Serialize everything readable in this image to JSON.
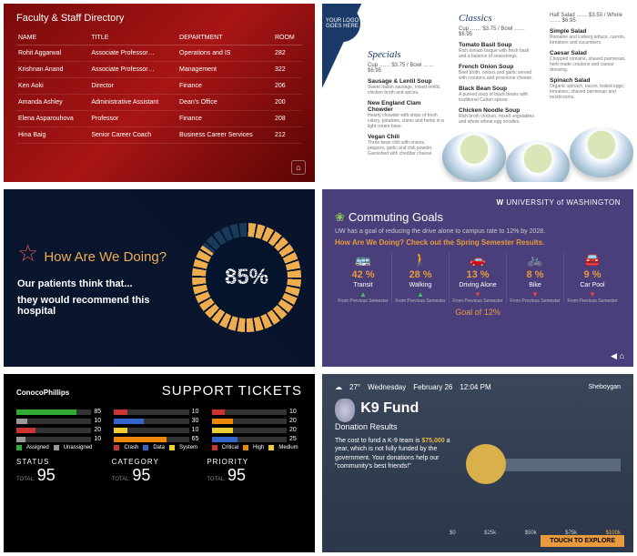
{
  "directory": {
    "title": "Faculty & Staff Directory",
    "headers": [
      "NAME",
      "TITLE",
      "DEPARTMENT",
      "ROOM"
    ],
    "rows": [
      [
        "Rohit Aggarwal",
        "Associate Professor…",
        "Operations and IS",
        "282"
      ],
      [
        "Krishnan Anand",
        "Associate Professor…",
        "Management",
        "322"
      ],
      [
        "Ken Aoki",
        "Director",
        "Finance",
        "206"
      ],
      [
        "Amanda Ashley",
        "Administrative Assistant",
        "Dean's Office",
        "200"
      ],
      [
        "Elena Asparouhova",
        "Professor",
        "Finance",
        "208"
      ],
      [
        "Hina Baig",
        "Senior Career Coach",
        "Business Career Services",
        "212"
      ]
    ]
  },
  "menu": {
    "logo": "YOUR LOGO GOES HERE",
    "specials": {
      "title": "Specials",
      "price": "Cup …… $3.75 / Bowl …… $6.95",
      "items": [
        {
          "name": "Sausage & Lentil Soup",
          "desc": "Sweet Italian sausage, mixed lentils, chicken broth and spices."
        },
        {
          "name": "New England Clam Chowder",
          "desc": "Hearty chowder with strips of fresh celery, potatoes, clams and herbs in a light cream base."
        },
        {
          "name": "Vegan Chili",
          "desc": "Three bean chili with onions, peppers, garlic and chili powder. Garnished with cheddar cheese."
        }
      ]
    },
    "classics": {
      "title": "Classics",
      "price": "Cup …… $3.75 / Bowl …… $6.95",
      "items": [
        {
          "name": "Tomato Basil Soup",
          "desc": "Rich tomato bisque with fresh basil and a balance of seasonings."
        },
        {
          "name": "French Onion Soup",
          "desc": "Beef broth, onions and garlic served with croutons and provolone cheese."
        },
        {
          "name": "Black Bean Soup",
          "desc": "A pureed soup of black beans with traditional Cuban spices."
        },
        {
          "name": "Chicken Noodle Soup",
          "desc": "Rich broth chicken, mixed vegetables and whole wheat egg noodles."
        }
      ]
    },
    "salads": {
      "price": "Half Salad …… $3.50 / Whole …… $6.95",
      "items": [
        {
          "name": "Simple Salad",
          "desc": "Romaine and iceberg lettuce, carrots, tomatoes and cucumbers."
        },
        {
          "name": "Caesar Salad",
          "desc": "Chopped romaine, shaved parmesan, herb made croutons and caesar dressing."
        },
        {
          "name": "Spinach Salad",
          "desc": "Organic spinach, bacon, boiled eggs, tomatoes, shaved parmesan and mushrooms."
        }
      ]
    }
  },
  "survey": {
    "heading": "How Are\nWe Doing?",
    "line1": "Our patients think that...",
    "line2": "they would recommend this hospital",
    "percent": "85%"
  },
  "commute": {
    "org": "UNIVERSITY of WASHINGTON",
    "title": "Commuting Goals",
    "desc": "UW has a goal of reducing the drive alone to campus rate to 12% by 2028.",
    "question": "How Are We Doing? Check out the Spring Semester Results.",
    "modes": [
      {
        "icon": "🚌",
        "pct": "42 %",
        "label": "Transit",
        "dir": "up"
      },
      {
        "icon": "🚶",
        "pct": "28 %",
        "label": "Walking",
        "dir": "up"
      },
      {
        "icon": "🚗",
        "pct": "13 %",
        "label": "Driving Alone",
        "dir": "dn"
      },
      {
        "icon": "🚲",
        "pct": "8 %",
        "label": "Bike",
        "dir": "dn"
      },
      {
        "icon": "🚘",
        "pct": "9 %",
        "label": "Car Pool",
        "dir": "dn"
      }
    ],
    "prev": "From Previous Semester",
    "goal": "Goal of 12%"
  },
  "tickets": {
    "brand": "ConocoPhillips",
    "title": "SUPPORT TICKETS",
    "col1": {
      "legend": [
        [
          "#3a3",
          "Assigned"
        ],
        [
          "#999",
          "Unassigned"
        ]
      ],
      "rows": [
        [
          85,
          "#3a3",
          80
        ],
        [
          10,
          "#999",
          15
        ],
        [
          20,
          "#c33",
          25
        ],
        [
          10,
          "#999",
          12
        ]
      ]
    },
    "col2": {
      "legend": [
        [
          "#c33",
          "Crash"
        ],
        [
          "#36c",
          "Data"
        ],
        [
          "#ec3",
          "System"
        ]
      ],
      "rows": [
        [
          10,
          "#c33",
          18
        ],
        [
          30,
          "#36c",
          40
        ],
        [
          10,
          "#ec3",
          18
        ],
        [
          65,
          "#e80",
          70
        ]
      ]
    },
    "col3": {
      "legend": [
        [
          "#c33",
          "Critical"
        ],
        [
          "#e80",
          "High"
        ],
        [
          "#ec3",
          "Medium"
        ]
      ],
      "rows": [
        [
          10,
          "#c33",
          18
        ],
        [
          20,
          "#e80",
          28
        ],
        [
          20,
          "#ec3",
          28
        ],
        [
          25,
          "#36c",
          34
        ]
      ]
    },
    "totals": [
      [
        "STATUS",
        "95"
      ],
      [
        "CATEGORY",
        "95"
      ],
      [
        "PRIORITY",
        "95"
      ]
    ],
    "totlbl": "TOTAL:"
  },
  "k9": {
    "temp": "27°",
    "weather_icon": "☁",
    "day": "Wednesday",
    "date": "February 26",
    "time": "12:04 PM",
    "city": "Sheboygan",
    "title": "K9 Fund",
    "sub": "Donation Results",
    "body": "The cost to fund a K-9 team is $75,000 a year, which is not fully funded by the government. Your donations help our \"community's best friends!\"",
    "amount": "$75,000",
    "scale": [
      "$0",
      "$25k",
      "$50k",
      "$75k",
      "$100k"
    ],
    "cta": "TOUCH TO EXPLORE"
  },
  "chart_data": [
    {
      "type": "gauge",
      "title": "How Are We Doing?",
      "value": 85,
      "max": 100,
      "unit": "%"
    },
    {
      "type": "bar",
      "title": "Commuting Goals",
      "categories": [
        "Transit",
        "Walking",
        "Driving Alone",
        "Bike",
        "Car Pool"
      ],
      "values": [
        42,
        28,
        13,
        8,
        9
      ],
      "goal": 12,
      "unit": "%"
    },
    {
      "type": "bar",
      "title": "Support Tickets",
      "series": [
        {
          "name": "Status",
          "categories": [
            "Assigned",
            "Unassigned",
            "",
            ""
          ],
          "values": [
            85,
            10,
            20,
            10
          ],
          "total": 95
        },
        {
          "name": "Category",
          "categories": [
            "Crash",
            "Data",
            "System",
            ""
          ],
          "values": [
            10,
            30,
            10,
            65
          ],
          "total": 95
        },
        {
          "name": "Priority",
          "categories": [
            "Critical",
            "High",
            "Medium",
            ""
          ],
          "values": [
            10,
            20,
            20,
            25
          ],
          "total": 95
        }
      ]
    },
    {
      "type": "progress",
      "title": "K9 Fund Donation Results",
      "value": 0,
      "max": 100000,
      "ticks": [
        0,
        25000,
        50000,
        75000,
        100000
      ],
      "unit": "$"
    }
  ]
}
